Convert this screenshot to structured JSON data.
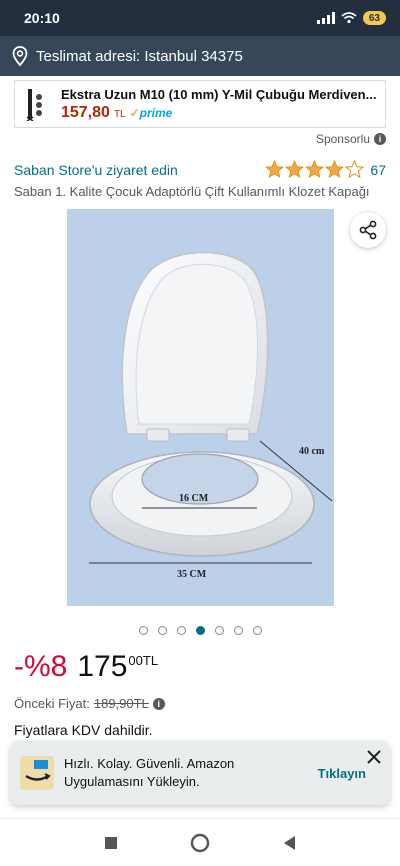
{
  "status_bar": {
    "time": "20:10",
    "battery": "63"
  },
  "delivery": {
    "label": "Teslimat adresi: Istanbul 34375"
  },
  "ad": {
    "title": "Ekstra Uzun M10 (10 mm) Y-Mil Çubuğu Merdiven...",
    "price": "157,80",
    "currency": "TL",
    "prime": "prime"
  },
  "sponsored": {
    "label": "Sponsorlu"
  },
  "product": {
    "store_link": "Saban Store'u ziyaret edin",
    "rating_value": 4,
    "rating_count": "67",
    "title": "Saban 1. Kalite Çocuk Adaptörlü Çift Kullanımlı Klozet Kapağı",
    "image_labels": {
      "height": "40 cm",
      "inner": "16 CM",
      "width": "35 CM"
    }
  },
  "gallery": {
    "count": 7,
    "active_index": 3
  },
  "price": {
    "discount": "-%8",
    "main": "175",
    "fraction": "00",
    "currency": "TL",
    "previous_label": "Önceki Fiyat:",
    "previous_value": "189,90TL",
    "vat_note": "Fiyatlara KDV dahildir."
  },
  "banner": {
    "text": "Hızlı. Kolay. Güvenli. Amazon Uygulamasını Yükleyin.",
    "cta": "Tıklayın"
  },
  "colors": {
    "link": "#007185",
    "discount": "#cc0c39",
    "star": "#f3a847",
    "header": "#232f3e"
  }
}
